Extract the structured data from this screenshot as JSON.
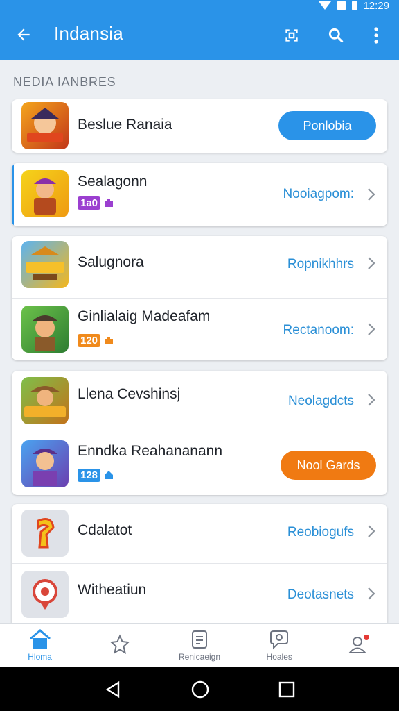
{
  "status_bar": {
    "time": "12:29"
  },
  "app_bar": {
    "title": "Indansia"
  },
  "section": {
    "label": "NEDIA IANBRES"
  },
  "cards": [
    {
      "rows": [
        {
          "name": "Beslue Ranaia",
          "button": "Ponlobia",
          "button_color": "#2a93e8"
        }
      ]
    },
    {
      "rows": [
        {
          "name": "Sealagonn",
          "badge": "1a0",
          "badge_color": "#9b3fd0",
          "action": "Nooiagpom:"
        }
      ]
    },
    {
      "rows": [
        {
          "name": "Salugnora",
          "action": "Ropnikhhrs"
        },
        {
          "name": "Ginlialaig Madeafam",
          "badge": "120",
          "badge_color": "#f08a1c",
          "action": "Rectanoom:"
        }
      ]
    },
    {
      "rows": [
        {
          "name": "Llena Cevshinsj",
          "action": "Neolagdcts"
        },
        {
          "name": "Enndka Reahananann",
          "badge": "128",
          "badge_color": "#2a93e8",
          "button": "Nool Gards",
          "button_color": "#f07a12"
        }
      ]
    },
    {
      "rows": [
        {
          "name": "Cdalatot",
          "action": "Reobiogufs"
        },
        {
          "name": "Witheatiun",
          "action": "Deotasnets"
        }
      ]
    }
  ],
  "bottom_nav": [
    {
      "label": "Hloma",
      "icon": "home-icon",
      "active": true
    },
    {
      "label": "",
      "icon": "star-icon"
    },
    {
      "label": "Renicaeign",
      "icon": "document-icon"
    },
    {
      "label": "Hoales",
      "icon": "chat-icon"
    },
    {
      "label": "",
      "icon": "profile-icon"
    }
  ],
  "colors": {
    "primary": "#2a93e8",
    "orange": "#f07a12",
    "link": "#2a8fd6"
  }
}
